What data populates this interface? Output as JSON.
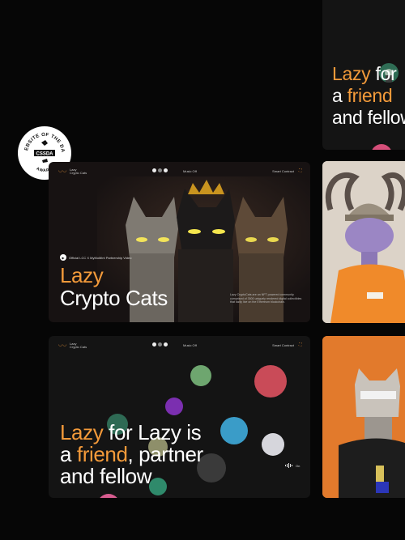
{
  "top_card": {
    "line1_a": "Lazy",
    "line1_b": "for",
    "line2_a": "a",
    "line2_b": "friend",
    "line3": "and fellow"
  },
  "award": {
    "top_text": "WEBSITE OF THE DAY",
    "logo_text": "CSSDA",
    "bottom_text": "AWARD"
  },
  "hero": {
    "brand_line1": "Lazy",
    "brand_line2": "Crypto Cats",
    "music_label": "Music Off",
    "contract_label": "Smart Contract",
    "video_label": "Official LCC X MyMoMint Partnership Video",
    "title_line1": "Lazy",
    "title_line2": "Crypto Cats",
    "description": "Lazy CryptoCats are an NFT powered community comprised of 3500 uniquely rendered digital collectibles that lazily live on the Ethereum blockchain."
  },
  "bottom": {
    "brand_line1": "Lazy",
    "brand_line2": "Crypto Cats",
    "music_label": "Music Off",
    "contract_label": "Smart Contract",
    "line1_a": "Lazy",
    "line1_b": "for Lazy is",
    "line2_a": "a",
    "line2_b": "friend",
    "line2_c": ", partner",
    "line3": "and fellow",
    "sound_label": "On"
  },
  "colors": {
    "accent": "#f39a3a",
    "background": "#060606",
    "card": "#141414",
    "orange_card": "#e07b2e"
  },
  "icons": [
    "play-icon",
    "sound-wave-icon",
    "expand-icon",
    "logo-icon"
  ]
}
